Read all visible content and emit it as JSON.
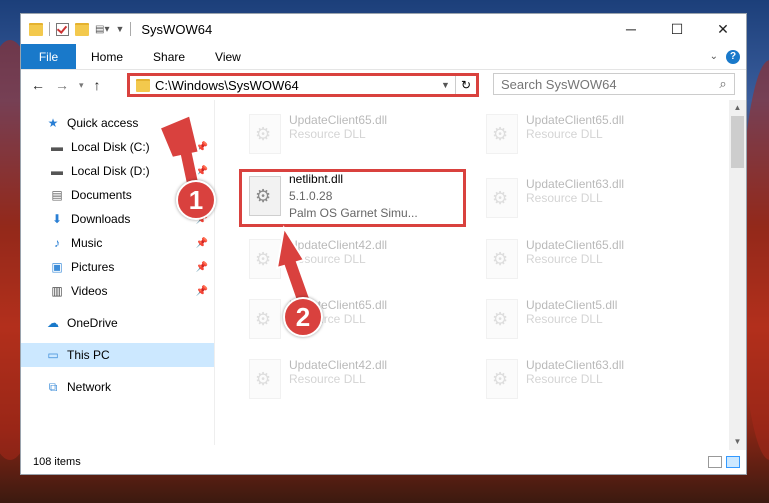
{
  "window": {
    "title": "SysWOW64"
  },
  "controls": {
    "minimize": "─",
    "maximize": "☐",
    "close": "✕"
  },
  "ribbon": {
    "file": "File",
    "tabs": [
      "Home",
      "Share",
      "View"
    ]
  },
  "address": {
    "path": "C:\\Windows\\SysWOW64",
    "refresh": "↻"
  },
  "search": {
    "placeholder": "Search SysWOW64"
  },
  "sidebar": {
    "items": [
      {
        "label": "Quick access",
        "icon": "star-icon",
        "pinned": false
      },
      {
        "label": "Local Disk (C:)",
        "icon": "drive-icon",
        "pinned": true
      },
      {
        "label": "Local Disk (D:)",
        "icon": "drive-icon",
        "pinned": true
      },
      {
        "label": "Documents",
        "icon": "documents-icon",
        "pinned": true
      },
      {
        "label": "Downloads",
        "icon": "downloads-icon",
        "pinned": true
      },
      {
        "label": "Music",
        "icon": "music-icon",
        "pinned": true
      },
      {
        "label": "Pictures",
        "icon": "pictures-icon",
        "pinned": true
      },
      {
        "label": "Videos",
        "icon": "videos-icon",
        "pinned": true
      },
      {
        "label": "OneDrive",
        "icon": "onedrive-icon",
        "pinned": false
      },
      {
        "label": "This PC",
        "icon": "this-pc-icon",
        "pinned": false,
        "selected": true
      },
      {
        "label": "Network",
        "icon": "network-icon",
        "pinned": false
      }
    ]
  },
  "files": [
    {
      "name": "UpdateClient65.dll",
      "sub": "Resource DLL",
      "faded": true
    },
    {
      "name": "UpdateClient65.dll",
      "sub": "Resource DLL",
      "faded": true
    },
    {
      "name": "netlibnt.dll",
      "sub": "5.1.0.28",
      "sub2": "Palm OS Garnet Simu...",
      "faded": false
    },
    {
      "name": "UpdateClient63.dll",
      "sub": "Resource DLL",
      "faded": true
    },
    {
      "name": "UpdateClient42.dll",
      "sub": "Resource DLL",
      "faded": true
    },
    {
      "name": "UpdateClient65.dll",
      "sub": "Resource DLL",
      "faded": true
    },
    {
      "name": "UpdateClient65.dll",
      "sub": "Resource DLL",
      "faded": true
    },
    {
      "name": "UpdateClient5.dll",
      "sub": "Resource DLL",
      "faded": true
    },
    {
      "name": "UpdateClient42.dll",
      "sub": "Resource DLL",
      "faded": true
    },
    {
      "name": "UpdateClient63.dll",
      "sub": "Resource DLL",
      "faded": true
    }
  ],
  "status": {
    "count": "108 items"
  },
  "annotations": {
    "step1": "1",
    "step2": "2",
    "color": "#d9413e"
  }
}
